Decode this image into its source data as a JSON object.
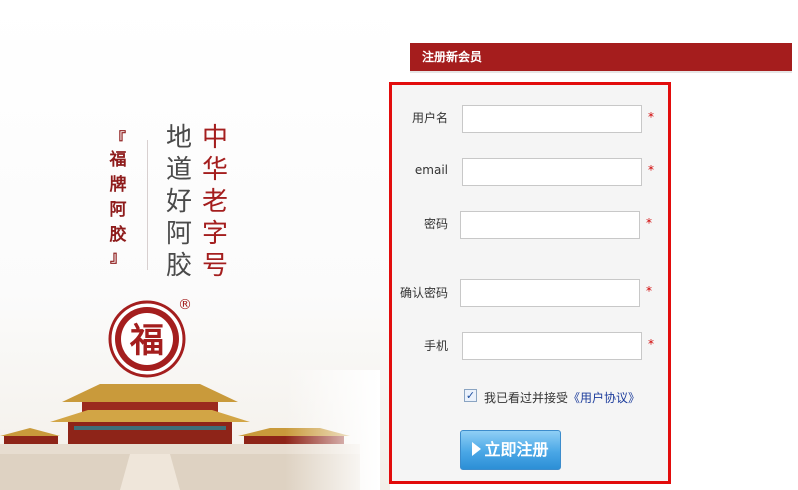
{
  "brand": {
    "slogan_vertical": "福牌阿胶",
    "bracket_open": "『",
    "bracket_close": "』",
    "motto_col1": "地道好阿胶",
    "motto_col2": "中华老字号",
    "seal_char": "福",
    "registered_mark": "®",
    "primary_color": "#a51d1d"
  },
  "form": {
    "header_title": "注册新会员",
    "fields": {
      "username": {
        "label": "用户名",
        "value": "",
        "required_mark": "*"
      },
      "email": {
        "label": "email",
        "value": "",
        "required_mark": "*"
      },
      "password": {
        "label": "密码",
        "value": "",
        "required_mark": "*"
      },
      "confirm_password": {
        "label": "确认密码",
        "value": "",
        "required_mark": "*"
      },
      "phone": {
        "label": "手机",
        "value": "",
        "required_mark": "*"
      }
    },
    "agreement": {
      "checked": true,
      "check_glyph": "✓",
      "prefix": "我已看过并接受",
      "link_text": "《用户协议》"
    },
    "submit_label": "立即注册",
    "highlight_color": "#e20c0c",
    "button_color": "#4aa7e6"
  }
}
